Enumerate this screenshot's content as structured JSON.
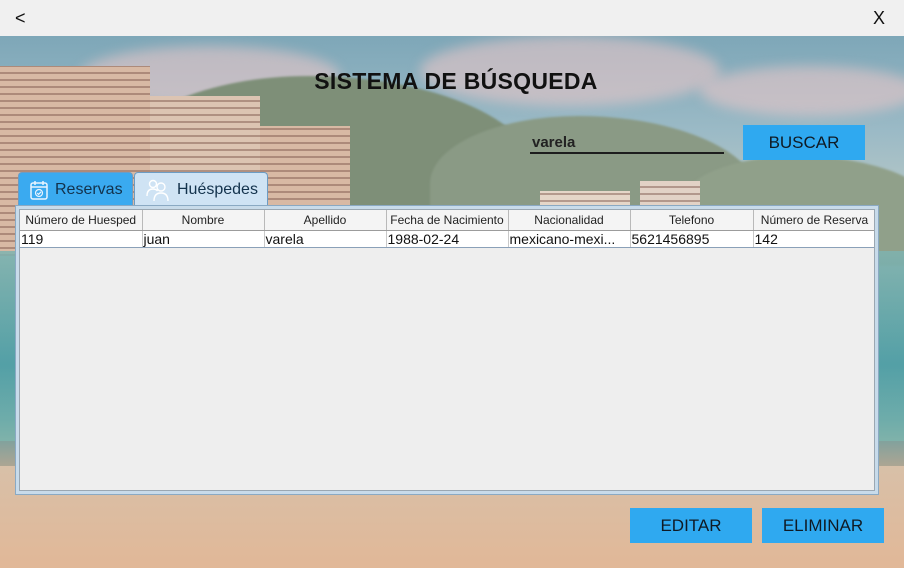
{
  "window": {
    "back_label": "<",
    "close_label": "X"
  },
  "header": {
    "title": "SISTEMA DE BÚSQUEDA"
  },
  "search": {
    "value": "varela",
    "button_label": "BUSCAR"
  },
  "tabs": [
    {
      "label": "Reservas",
      "icon": "calendar-check-icon",
      "active": true
    },
    {
      "label": "Huéspedes",
      "icon": "users-icon",
      "active": false
    }
  ],
  "table": {
    "columns": [
      "Número de Huesped",
      "Nombre",
      "Apellido",
      "Fecha de Nacimiento",
      "Nacionalidad",
      "Telefono",
      "Número de Reserva"
    ],
    "rows": [
      [
        "119",
        "juan",
        "varela",
        "1988-02-24",
        "mexicano-mexi...",
        "5621456895",
        "142"
      ]
    ]
  },
  "actions": {
    "edit_label": "EDITAR",
    "delete_label": "ELIMINAR"
  },
  "colors": {
    "accent": "#2fa9f0",
    "tab_active": "#3aaaf0",
    "tab_inactive": "#cfe3f4"
  }
}
